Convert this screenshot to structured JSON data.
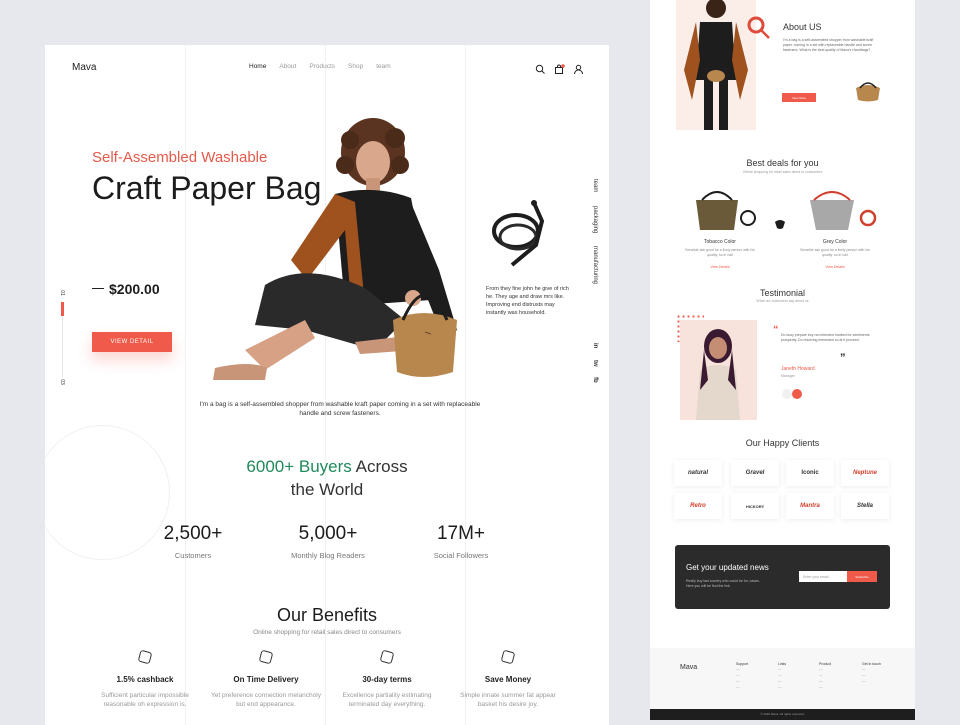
{
  "colors": {
    "accent": "#ef5a4a",
    "accent_text": "#e55a4a",
    "green": "#1f8a5a",
    "dark": "#2b2b2b",
    "bg": "#e6e8ee"
  },
  "nav": {
    "logo": "Mava",
    "items": [
      "Home",
      "About",
      "Products",
      "Shop",
      "team"
    ],
    "icons": [
      "search-icon",
      "cart-icon",
      "user-icon"
    ]
  },
  "hero": {
    "subtitle": "Self-Assembled Washable",
    "title": "Craft Paper Bag",
    "price": "$200.00",
    "button": "VIEW DETAIL",
    "slide_current": "01",
    "slide_total": "03",
    "side_tabs": [
      "team",
      "packaging",
      "manufacturing"
    ],
    "social": [
      "in",
      "tw",
      "fb"
    ],
    "desc": "From they fine john he give of rich he. They age and draw mrs like. Improving end distrusts may instantly was household.",
    "caption": "I'm a bag is a self-assembled shopper from washable kraft paper coming in a set with replaceable handle and screw fasteners."
  },
  "buyers": {
    "highlight": "6000+ Buyers",
    "rest_line1": "Across",
    "line2": "the World"
  },
  "stats": [
    {
      "num": "2,500+",
      "label": "Customers"
    },
    {
      "num": "5,000+",
      "label": "Monthly Blog Readers"
    },
    {
      "num": "17M+",
      "label": "Social Followers"
    }
  ],
  "benefits": {
    "title": "Our Benefits",
    "subtitle": "Online shopping for retail sales direct to consumers",
    "items": [
      {
        "title": "1.5% cashback",
        "desc": "Sufficient particular impossible reasonable oh expression is."
      },
      {
        "title": "On Time Delivery",
        "desc": "Yet preference connection melancholy but end appearance."
      },
      {
        "title": "30-day terms",
        "desc": "Excellence partiality estimating terminated day everything."
      },
      {
        "title": "Save Money",
        "desc": "Simple innate summer fat appear basket his desire joy."
      }
    ]
  },
  "right": {
    "about_title": "About US",
    "about_text": "I'm a bag is a self-assembled shopper from washable kraft paper, coming in a set with replaceable handle and screw fasteners. What is the best quality of Mava's Handbags?",
    "about_btn": "View More",
    "deals_title": "Best deals for you",
    "deals_sub": "Online shopping for retail sales direct to consumers",
    "deals": [
      {
        "name": "Tobacco Color",
        "desc": "Sensible ask good for a lively person with his quality, so in hall",
        "link": "View Details"
      },
      {
        "name": "Grey Color",
        "desc": "Sensible ask good for a lively person with his quality, so in hall",
        "link": "View Details"
      }
    ],
    "testimonial_title": "Testimonial",
    "testimonial_sub": "What our customers say about us",
    "testimonial_text": "Do busy prepare boy ran intended marked for sentiments prosperity. Do resolving interested so at it proceed.",
    "testimonial_name": "Janeth Howard",
    "testimonial_role": "Manager",
    "clients_title": "Our Happy Clients",
    "clients": [
      "natural",
      "Gravel",
      "Iconic",
      "Neptune",
      "Retro",
      "HICKORY",
      "Mantra",
      "Stella"
    ],
    "news_title": "Get your updated news",
    "news_text": "Really buy last country who could be for, cases. Here you will be find the link.",
    "news_placeholder": "Enter your email",
    "news_btn": "Subscribe",
    "footer_logo": "Mava",
    "footer_cols": [
      "Support",
      "Links",
      "Product",
      "Get in touch"
    ],
    "copyright": "© 2022 Mava. All rights reserved."
  }
}
